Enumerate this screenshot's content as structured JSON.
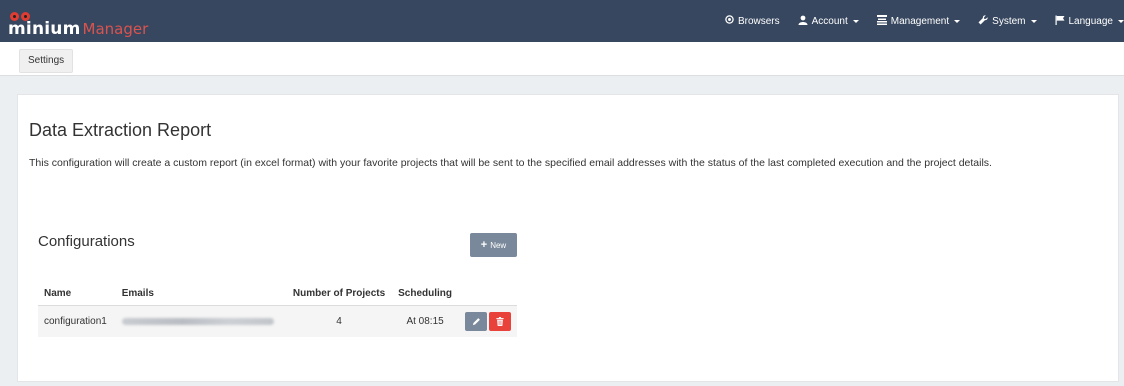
{
  "brand": {
    "name": "minium",
    "suffix": "Manager"
  },
  "nav": {
    "browsers": {
      "label": "Browsers",
      "icon": "browser-target-icon"
    },
    "account": {
      "label": "Account",
      "icon": "user-icon"
    },
    "management": {
      "label": "Management",
      "icon": "management-icon"
    },
    "system": {
      "label": "System",
      "icon": "wrench-icon"
    },
    "language": {
      "label": "Language",
      "icon": "flag-icon"
    }
  },
  "subnav": {
    "settings_label": "Settings"
  },
  "page": {
    "title": "Data Extraction Report",
    "description": "This configuration will create a custom report (in excel format) with your favorite projects that will be sent to the specified email addresses with the status of the last completed execution and the project details."
  },
  "configurations": {
    "title": "Configurations",
    "new_label": "New",
    "columns": {
      "name": "Name",
      "emails": "Emails",
      "projects": "Number of Projects",
      "scheduling": "Scheduling"
    },
    "rows": [
      {
        "name": "configuration1",
        "emails": "",
        "projects": "4",
        "scheduling": "At 08:15"
      }
    ]
  },
  "colors": {
    "navbar": "#37475f",
    "brand_accent": "#d9534f",
    "secondary_button": "#79889a",
    "danger_button": "#e8423b"
  }
}
